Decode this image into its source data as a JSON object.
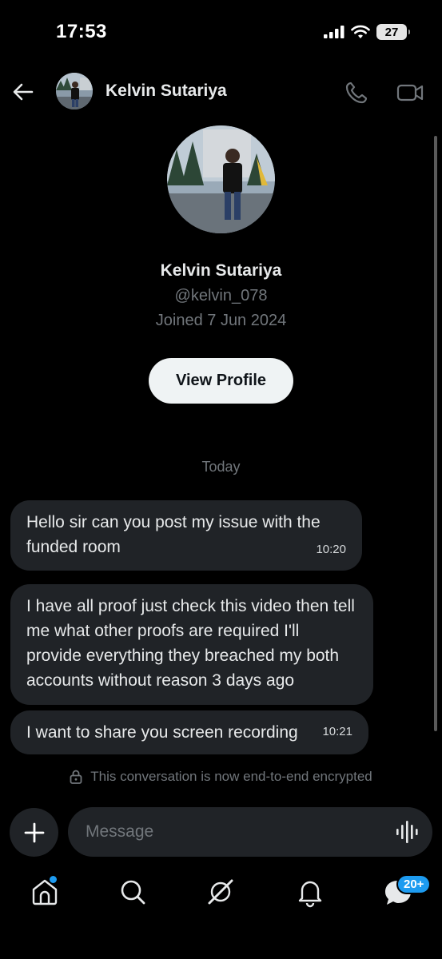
{
  "status_bar": {
    "time": "17:53",
    "battery": "27",
    "icons": [
      "signal-icon",
      "wifi-icon",
      "battery-icon"
    ]
  },
  "header": {
    "name": "Kelvin Sutariya",
    "icons": [
      "back-arrow-icon",
      "phone-icon",
      "video-icon"
    ]
  },
  "profile": {
    "name": "Kelvin Sutariya",
    "handle": "@kelvin_078",
    "joined": "Joined 7 Jun 2024",
    "view_profile_label": "View Profile"
  },
  "conversation": {
    "day_label": "Today",
    "messages": [
      {
        "text": "Hello sir can you post my issue with the funded room",
        "time": "10:20"
      },
      {
        "text": "I have all proof just check this video then tell me what other proofs are required I'll provide everything they breached my both accounts without reason 3 days ago",
        "time": ""
      },
      {
        "text": "I want to share you screen recording",
        "time": "10:21"
      }
    ],
    "encryption_notice": "This conversation is now end-to-end encrypted"
  },
  "composer": {
    "placeholder": "Message"
  },
  "bottom_nav": {
    "items": [
      "home-icon",
      "search-icon",
      "grok-icon",
      "notifications-icon",
      "messages-icon"
    ],
    "messages_badge": "20+"
  },
  "colors": {
    "background": "#000000",
    "bubble": "#202327",
    "accent": "#1d9bf0",
    "muted_text": "#71767b"
  }
}
